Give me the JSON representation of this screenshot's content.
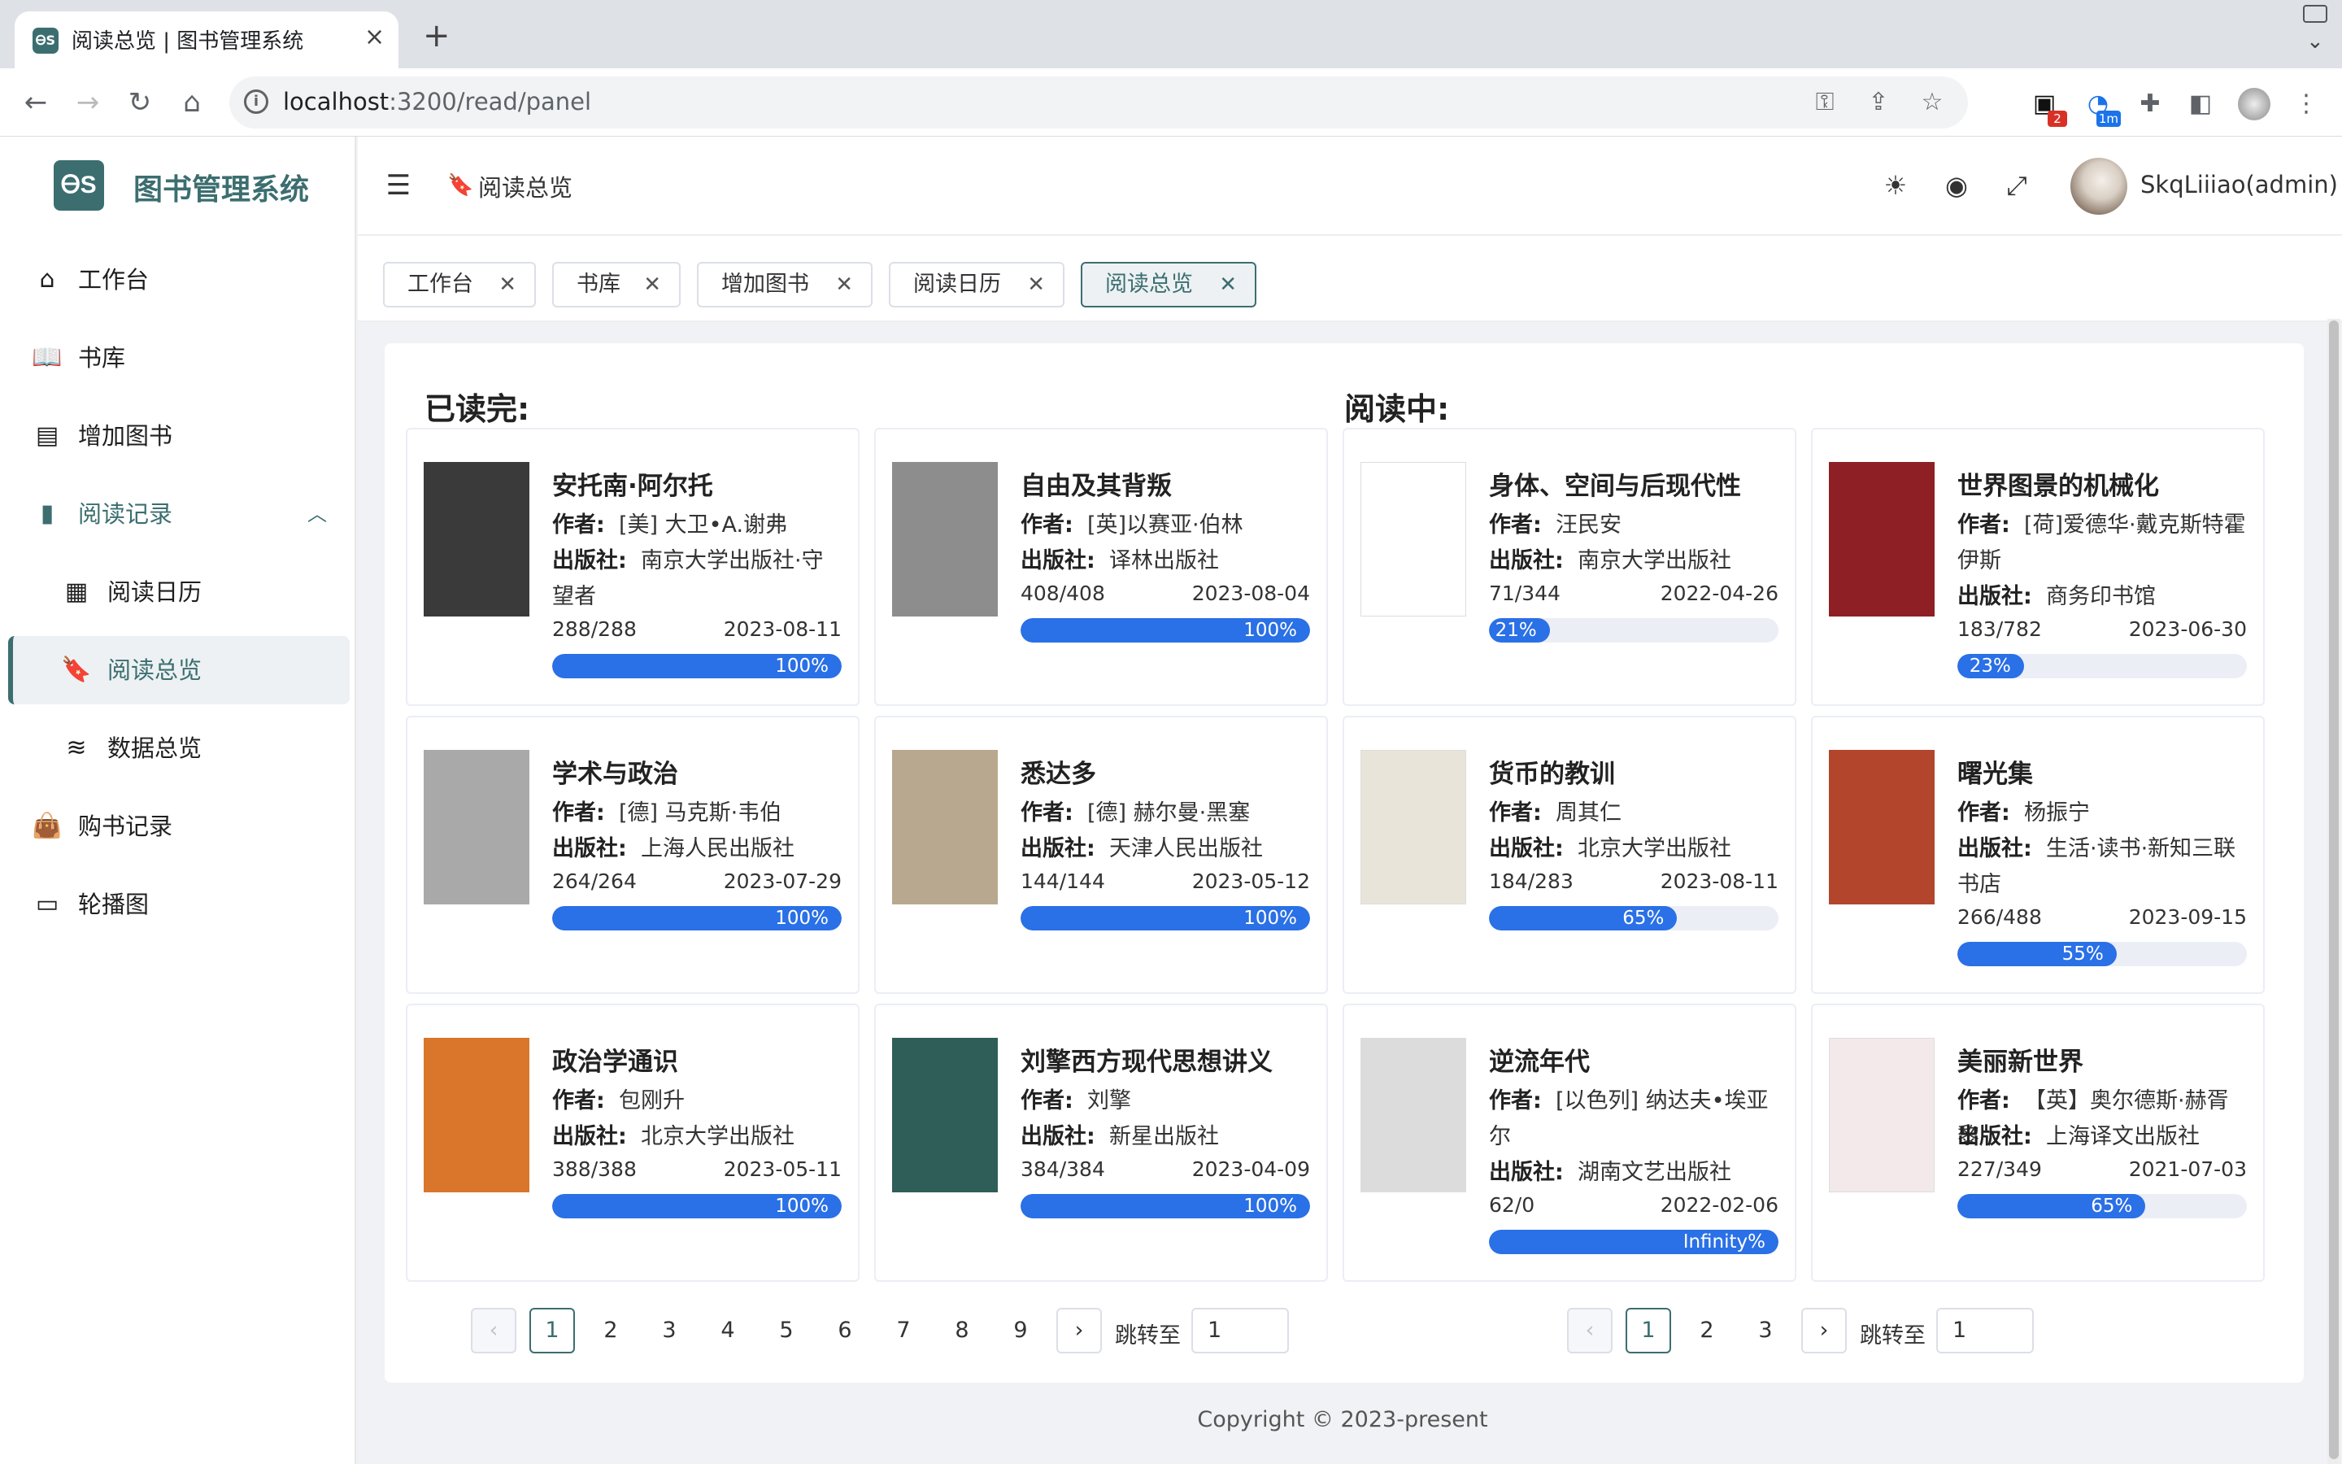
{
  "browser": {
    "tab_title": "阅读总览 | 图书管理系统",
    "url_host": "localhost",
    "url_path": ":3200/read/panel",
    "ext_badge_1": "2",
    "ext_badge_2": "1m"
  },
  "app": {
    "title": "图书管理系统",
    "logo_text": "ᎾS"
  },
  "sidebar": {
    "items": [
      {
        "label": "工作台",
        "icon": "home-icon"
      },
      {
        "label": "书库",
        "icon": "book-open-icon"
      },
      {
        "label": "增加图书",
        "icon": "book-add-icon"
      },
      {
        "label": "阅读记录",
        "icon": "bookmark-icon"
      },
      {
        "label": "阅读日历",
        "icon": "calendar-icon"
      },
      {
        "label": "阅读总览",
        "icon": "bookmark-check-icon"
      },
      {
        "label": "数据总览",
        "icon": "database-icon"
      },
      {
        "label": "购书记录",
        "icon": "shopping-bag-icon"
      },
      {
        "label": "轮播图",
        "icon": "carousel-icon"
      }
    ]
  },
  "header": {
    "breadcrumb": "阅读总览",
    "username": "SkqLiiiao(admin)"
  },
  "tags": [
    "工作台",
    "书库",
    "增加图书",
    "阅读日历",
    "阅读总览"
  ],
  "labels": {
    "author": "作者:",
    "publisher": "出版社:",
    "jump_to": "跳转至"
  },
  "finished": {
    "title": "已读完:",
    "books": [
      {
        "title": "安托南·阿尔托",
        "author": "[美] 大卫•A.谢弗",
        "publisher": "南京大学出版社·守望者",
        "pages": "288/288",
        "date": "2023-08-11",
        "progress": 100,
        "progress_label": "100%",
        "cover_color": "#3a3a3a"
      },
      {
        "title": "自由及其背叛",
        "author": "[英]以赛亚·伯林",
        "publisher": "译林出版社",
        "pages": "408/408",
        "date": "2023-08-04",
        "progress": 100,
        "progress_label": "100%",
        "cover_color": "#8d8d8d"
      },
      {
        "title": "学术与政治",
        "author": "[德] 马克斯·韦伯",
        "publisher": "上海人民出版社",
        "pages": "264/264",
        "date": "2023-07-29",
        "progress": 100,
        "progress_label": "100%",
        "cover_color": "#a9a9a9"
      },
      {
        "title": "悉达多",
        "author": "[德] 赫尔曼·黑塞",
        "publisher": "天津人民出版社",
        "pages": "144/144",
        "date": "2023-05-12",
        "progress": 100,
        "progress_label": "100%",
        "cover_color": "#b8a88f"
      },
      {
        "title": "政治学通识",
        "author": "包刚升",
        "publisher": "北京大学出版社",
        "pages": "388/388",
        "date": "2023-05-11",
        "progress": 100,
        "progress_label": "100%",
        "cover_color": "#d9762b"
      },
      {
        "title": "刘擎西方现代思想讲义",
        "author": "刘擎",
        "publisher": "新星出版社",
        "pages": "384/384",
        "date": "2023-04-09",
        "progress": 100,
        "progress_label": "100%",
        "cover_color": "#2f5d57"
      }
    ],
    "pager": {
      "pages": [
        "1",
        "2",
        "3",
        "4",
        "5",
        "6",
        "7",
        "8",
        "9"
      ],
      "current": "1",
      "jump_value": "1"
    }
  },
  "reading": {
    "title": "阅读中:",
    "books": [
      {
        "title": "身体、空间与后现代性",
        "author": "汪民安",
        "publisher": "南京大学出版社",
        "pages": "71/344",
        "date": "2022-04-26",
        "progress": 21,
        "progress_label": "21%",
        "cover_color": "#ffffff"
      },
      {
        "title": "世界图景的机械化",
        "author": "[荷]爱德华·戴克斯特霍伊斯",
        "publisher": "商务印书馆",
        "pages": "183/782",
        "date": "2023-06-30",
        "progress": 23,
        "progress_label": "23%",
        "cover_color": "#8e1f24"
      },
      {
        "title": "货币的教训",
        "author": "周其仁",
        "publisher": "北京大学出版社",
        "pages": "184/283",
        "date": "2023-08-11",
        "progress": 65,
        "progress_label": "65%",
        "cover_color": "#e9e4da"
      },
      {
        "title": "曙光集",
        "author": "杨振宁",
        "publisher": "生活·读书·新知三联书店",
        "pages": "266/488",
        "date": "2023-09-15",
        "progress": 55,
        "progress_label": "55%",
        "cover_color": "#b3452c"
      },
      {
        "title": "逆流年代",
        "author": "[以色列] 纳达夫•埃亚尔",
        "publisher": "湖南文艺出版社",
        "pages": "62/0",
        "date": "2022-02-06",
        "progress": 100,
        "progress_label": "Infinity%",
        "cover_color": "#dcdcdc"
      },
      {
        "title": "美丽新世界",
        "author": "【英】奥尔德斯·赫胥黎",
        "publisher": "上海译文出版社",
        "pages": "227/349",
        "date": "2021-07-03",
        "progress": 65,
        "progress_label": "65%",
        "cover_color": "#f3e9ea"
      }
    ],
    "pager": {
      "pages": [
        "1",
        "2",
        "3"
      ],
      "current": "1",
      "jump_value": "1"
    }
  },
  "footer": "Copyright © 2023-present"
}
